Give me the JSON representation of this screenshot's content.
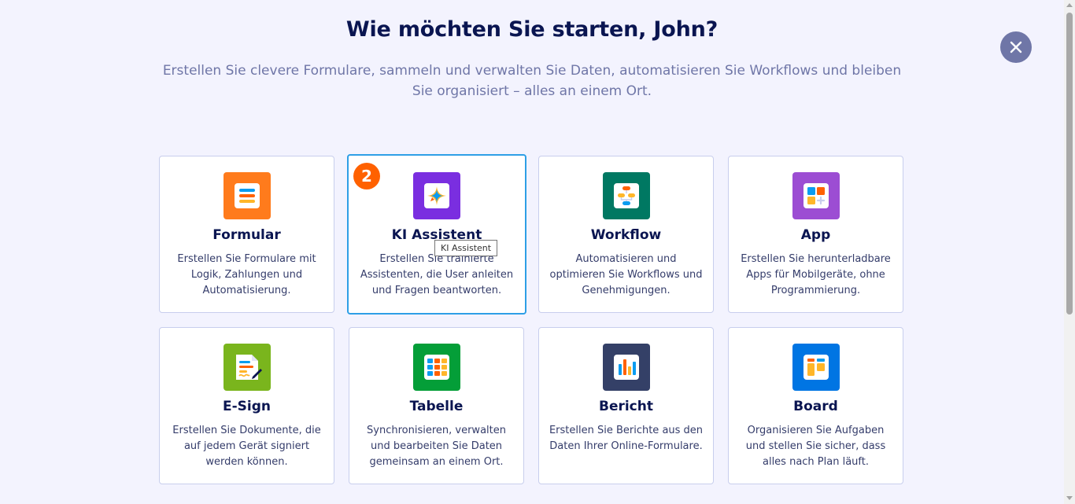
{
  "header": {
    "title": "Wie möchten Sie starten, John?",
    "subtitle": "Erstellen Sie clevere Formulare, sammeln und verwalten Sie Daten, automatisieren Sie Workflows und bleiben Sie organisiert – alles an einem Ort."
  },
  "close_icon": "close-icon",
  "cards": [
    {
      "title": "Formular",
      "desc": "Erstellen Sie Formulare mit Logik, Zahlungen und Automatisierung.",
      "color": "#ff7b1c",
      "icon": "form-icon"
    },
    {
      "title": "KI Assistent",
      "desc": "Erstellen Sie trainierte Assistenten, die User anleiten und Fragen beantworten.",
      "color": "#7a2ee0",
      "icon": "ai-sparkle-icon",
      "badge": "2"
    },
    {
      "title": "Workflow",
      "desc": "Automatisieren und optimieren Sie Workflows und Genehmigungen.",
      "color": "#007862",
      "icon": "workflow-icon"
    },
    {
      "title": "App",
      "desc": "Erstellen Sie herunterladbare Apps für Mobilgeräte, ohne Programmierung.",
      "color": "#9c4dd3",
      "icon": "app-icon"
    },
    {
      "title": "E-Sign",
      "desc": "Erstellen Sie Dokumente, die auf jedem Gerät signiert werden können.",
      "color": "#7ab51d",
      "icon": "esign-icon"
    },
    {
      "title": "Tabelle",
      "desc": "Synchronisieren, verwalten und bearbeiten Sie Daten gemeinsam an einem Ort.",
      "color": "#049e38",
      "icon": "table-icon"
    },
    {
      "title": "Bericht",
      "desc": "Erstellen Sie Berichte aus den Daten Ihrer Online-Formulare.",
      "color": "#344067",
      "icon": "report-icon"
    },
    {
      "title": "Board",
      "desc": "Organisieren Sie Aufgaben und stellen Sie sicher, dass alles nach Plan läuft.",
      "color": "#0075e3",
      "icon": "board-icon"
    }
  ],
  "tooltip": "KI Assistent"
}
